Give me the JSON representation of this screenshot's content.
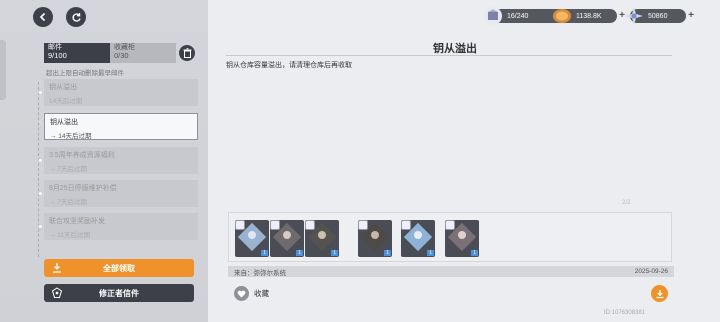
{
  "nav": {
    "back_icon": "back-arrow-icon",
    "refresh_icon": "refresh-icon"
  },
  "resources": [
    {
      "icon": "crate-icon",
      "value": "16/240"
    },
    {
      "icon": "coin-icon",
      "value": "1138.8K"
    },
    {
      "icon": "crystal-icon",
      "value": "50860"
    }
  ],
  "sidebar": {
    "tab_mail_label": "邮件",
    "tab_mail_value": "9/100",
    "tab_fav_label": "收藏柜",
    "tab_fav_value": "0/30",
    "overflow_note": "超出上限自动删除最早邮件",
    "mails": [
      {
        "title": "钥从溢出",
        "expiry": "14天后过期"
      },
      {
        "title": "钥从溢出",
        "expiry": "→ 14天后过期"
      },
      {
        "title": "3.5周年养成资源福利",
        "expiry": "→ 7天后过期"
      },
      {
        "title": "9月25日停服维护补偿",
        "expiry": "→ 7天后过期"
      },
      {
        "title": "联合攻坚奖励补发",
        "expiry": "→ 11天后过期"
      }
    ],
    "claim_all_label": "全部领取",
    "fixer_mail_label": "修正者信件"
  },
  "mail": {
    "title": "钥从溢出",
    "body": "钥从仓库容量溢出，请清理仓库后再收取",
    "from": "来自：弥弥尔系统",
    "date": "2025-09-26",
    "favorite_label": "收藏",
    "watermark": "2/2",
    "attachments": [
      {
        "qty": "1"
      },
      {
        "qty": "1"
      },
      {
        "qty": "1"
      },
      {
        "qty": "1"
      },
      {
        "qty": "1"
      },
      {
        "qty": "1"
      }
    ]
  },
  "uid": "ID:1076308381",
  "colors": {
    "accent": "#f0922c",
    "dark": "#3d4048",
    "panel": "#d3d5da"
  }
}
